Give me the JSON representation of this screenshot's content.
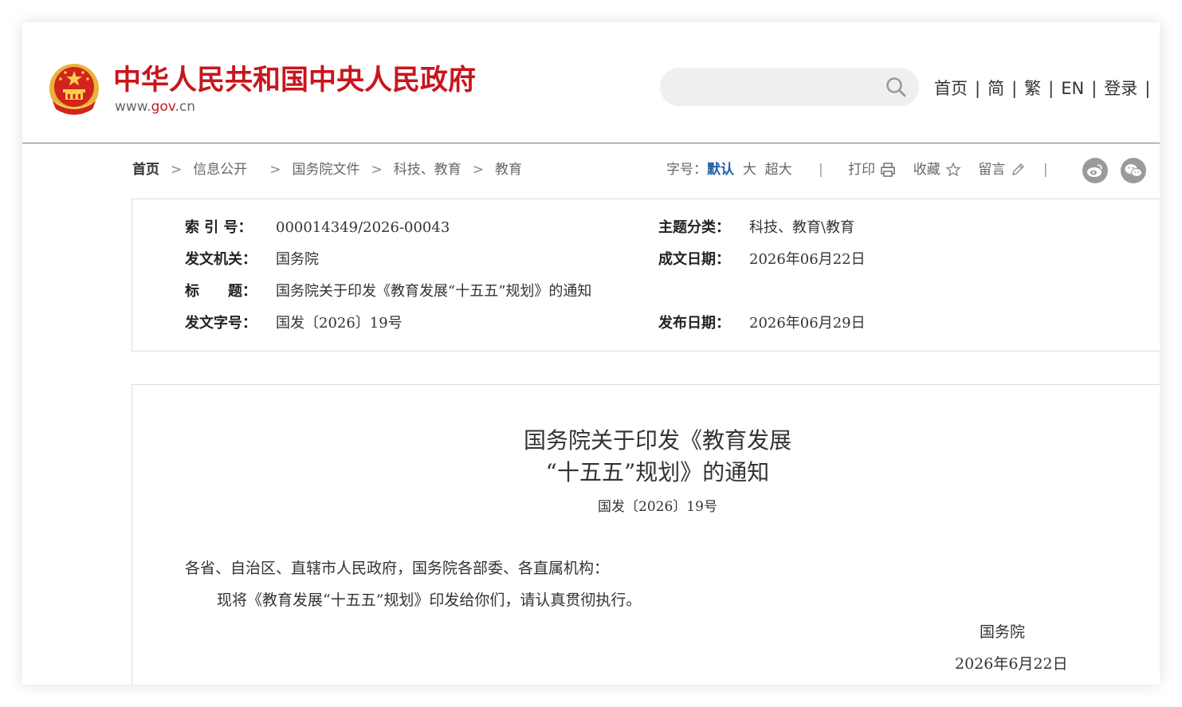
{
  "header": {
    "site_title": "中华人民共和国中央人民政府",
    "url_prefix": "www.",
    "url_mid": "gov",
    "url_suffix": ".cn",
    "search_placeholder": "",
    "nav": [
      "首页",
      "简",
      "繁",
      "EN",
      "登录"
    ],
    "nav_sep": "|",
    "brand_color": "#c8161d"
  },
  "breadcrumb": {
    "items": [
      "首页",
      "信息公开",
      "国务院文件",
      "科技、教育",
      "教育"
    ],
    "arrow": ">"
  },
  "toolbar": {
    "font_size_label": "字号：",
    "size_default": "默认",
    "size_large": "大",
    "size_xlarge": "超大",
    "print": "打印",
    "favorite": "收藏",
    "comment": "留言",
    "pipe": "|"
  },
  "meta": {
    "index_label": "索 引 号：",
    "index_value": "000014349/2026-00043",
    "topic_label": "主题分类：",
    "topic_value": "科技、教育\\教育",
    "issuer_label": "发文机关：",
    "issuer_value": "国务院",
    "written_label": "成文日期：",
    "written_value": "2026年06月22日",
    "title_label": "标　　题：",
    "title_value": "国务院关于印发《教育发展“十五五”规划》的通知",
    "docnum_label": "发文字号：",
    "docnum_value": "国发〔2026〕19号",
    "published_label": "发布日期：",
    "published_value": "2026年06月29日"
  },
  "article": {
    "title_line1": "国务院关于印发《教育发展",
    "title_line2": "“十五五”规划》的通知",
    "doc_number": "国发〔2026〕19号",
    "salutation": "各省、自治区、直辖市人民政府，国务院各部委、各直属机构：",
    "body": "现将《教育发展“十五五”规划》印发给你们，请认真贯彻执行。",
    "signature": "国务院",
    "date": "2026年6月22日"
  }
}
